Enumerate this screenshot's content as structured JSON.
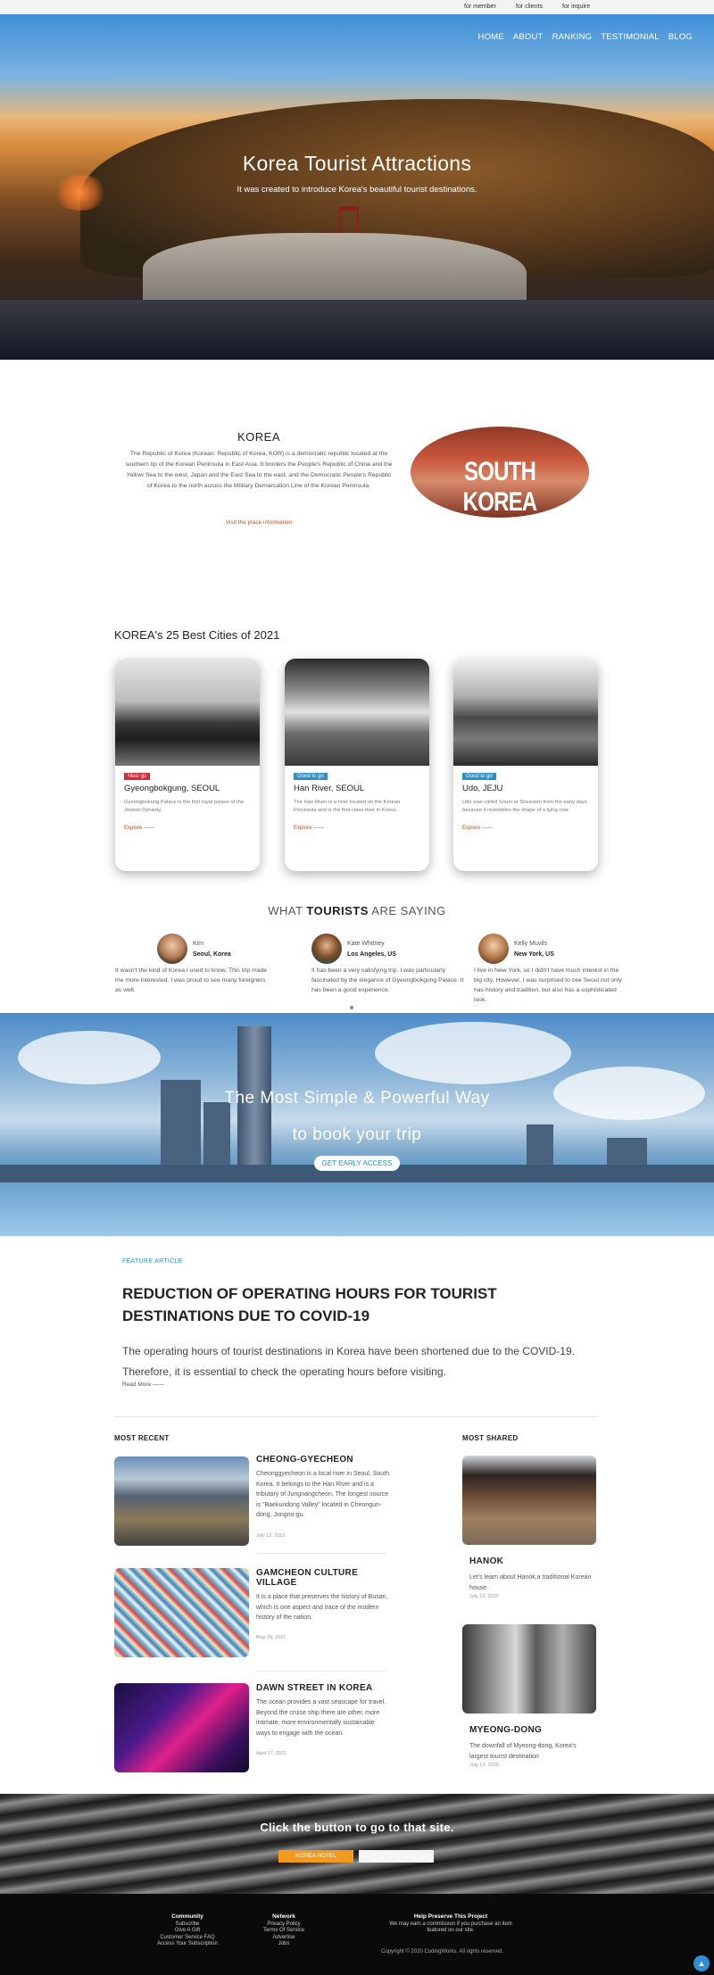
{
  "topbar": {
    "links": [
      "for member",
      "for clients",
      "for inquire"
    ]
  },
  "nav": {
    "items": [
      "HOME",
      "ABOUT",
      "RANKING",
      "TESTIMONIAL",
      "BLOG"
    ]
  },
  "hero": {
    "title": "Korea Tourist Attractions",
    "subtitle": "It was created to introduce Korea's beautiful tourist destinations."
  },
  "korea": {
    "title": "KOREA",
    "text": "The Republic of Korea (Korean: Republic of Korea, KOR) is a democratic republic located at the southern tip of the Korean Peninsula in East Asia. It borders the People's Republic of China and the Yellow Sea to the west, Japan and the East Sea to the east, and the Democratic People's Republic of Korea to the north across the Military Demarcation Line of the Korean Peninsula.",
    "link": "Visit the place information",
    "badge": "SOUTH KOREA"
  },
  "cities": {
    "title": "KOREA's 25 Best Cities of 2021",
    "cards": [
      {
        "tag": "Must go",
        "tag_color": "#d9263a",
        "name": "Gyeongbokgung, SEOUL",
        "desc": "Gyeongbokung Palace is the first royal palace of the Joseon Dynasty.",
        "more": "Explore ——"
      },
      {
        "tag": "Good to go",
        "tag_color": "#2f8fc8",
        "name": "Han River, SEOUL",
        "desc": "The Han River is a river located on the Korean Peninsula and is the first-class river in Korea.",
        "more": "Explore ——"
      },
      {
        "tag": "Good to go",
        "tag_color": "#2f8fc8",
        "name": "Udo, JEJU",
        "desc": "Udo was called Soum or Sheesom from the early days because it resembles the shape of a lying cow.",
        "more": "Explore ——"
      }
    ]
  },
  "testimonials": {
    "heading_pre": "WHAT ",
    "heading_bold": "TOURISTS",
    "heading_post": " ARE SAYING",
    "items": [
      {
        "name": "Kim",
        "location": "Seoul, Korea",
        "text": "It wasn't the kind of Korea I used to know. This trip made me more interested. I was proud to see many foreigners as well."
      },
      {
        "name": "Kate Whitney",
        "location": "Los Angeles, US",
        "text": "It has been a very satisfying trip. I was particularly fascinated by the elegance of Gyeongbokgung Palace. It has been a good experience."
      },
      {
        "name": "Kelly Muvils",
        "location": "New York, US",
        "text": "I live in New York, so I didn't have much interest in the big city. However, I was surprised to see Seoul not only has history and tradition, but also has a sophisticated look."
      }
    ]
  },
  "banner": {
    "line1": "The Most Simple & Powerful Way",
    "line2": "to book your trip",
    "button": "GET EARLY ACCESS"
  },
  "feature": {
    "label": "FEATURE ARTICLE",
    "title": "REDUCTION OF OPERATING HOURS FOR TOURIST DESTINATIONS DUE TO COVID-19",
    "text": "The operating hours of tourist destinations in Korea have been shortened due to the COVID-19. Therefore, it is essential to check the operating hours before visiting.",
    "more": "Read More ——"
  },
  "recent": {
    "heading": "MOST RECENT",
    "items": [
      {
        "title": "CHEONG-GYECHEON",
        "text": "Cheonggyecheon is a local river in Seoul, South Korea. It belongs to the Han River and is a tributary of Jungnangcheon. The longest source is \"Baekundong Valley\" located in Cheongun-dong, Jongno-gu.",
        "date": "July 12, 2021"
      },
      {
        "title": "GAMCHEON CULTURE VILLAGE",
        "text": "It is a place that preserves the history of Busan, which is one aspect and trace of the modern history of the nation.",
        "date": "May 30, 2021"
      },
      {
        "title": "DAWN STREET IN KOREA",
        "text": "The ocean provides a vast seascape for travel. Beyond the cruise ship there are other, more intimate, more environmentally sustainable ways to engage with the ocean.",
        "date": "April 17, 2021"
      }
    ]
  },
  "shared": {
    "heading": "MOST SHARED",
    "items": [
      {
        "title": "HANOK",
        "text": "Let's learn about Hanok,a traditional Korean house",
        "date": "July 12, 2020"
      },
      {
        "title": "MYEONG-DONG",
        "text": "The downfall of Myeong-dong, Korea's largest tourist destination",
        "date": "July 12, 2020"
      }
    ]
  },
  "cta": {
    "title": "Click the button to go to that site.",
    "button": "KOREA HOTEL"
  },
  "footer": {
    "col1": {
      "heading": "Community",
      "links": [
        "Subscribe",
        "Give A Gift",
        "Customer Service FAQ",
        "Access Your Subscription"
      ]
    },
    "col2": {
      "heading": "Network",
      "links": [
        "Privacy Policy",
        "Terms Of Service",
        "Advertise",
        "Jobs"
      ]
    },
    "col3": {
      "heading": "Help Preserve This Project",
      "lines": [
        "We may earn a commission if you purchase an item",
        "featured on our site."
      ]
    },
    "copyright": "Copyright © 2020 CodingWorks. All rights reserved.",
    "top_icon": "arrow-up-icon"
  }
}
